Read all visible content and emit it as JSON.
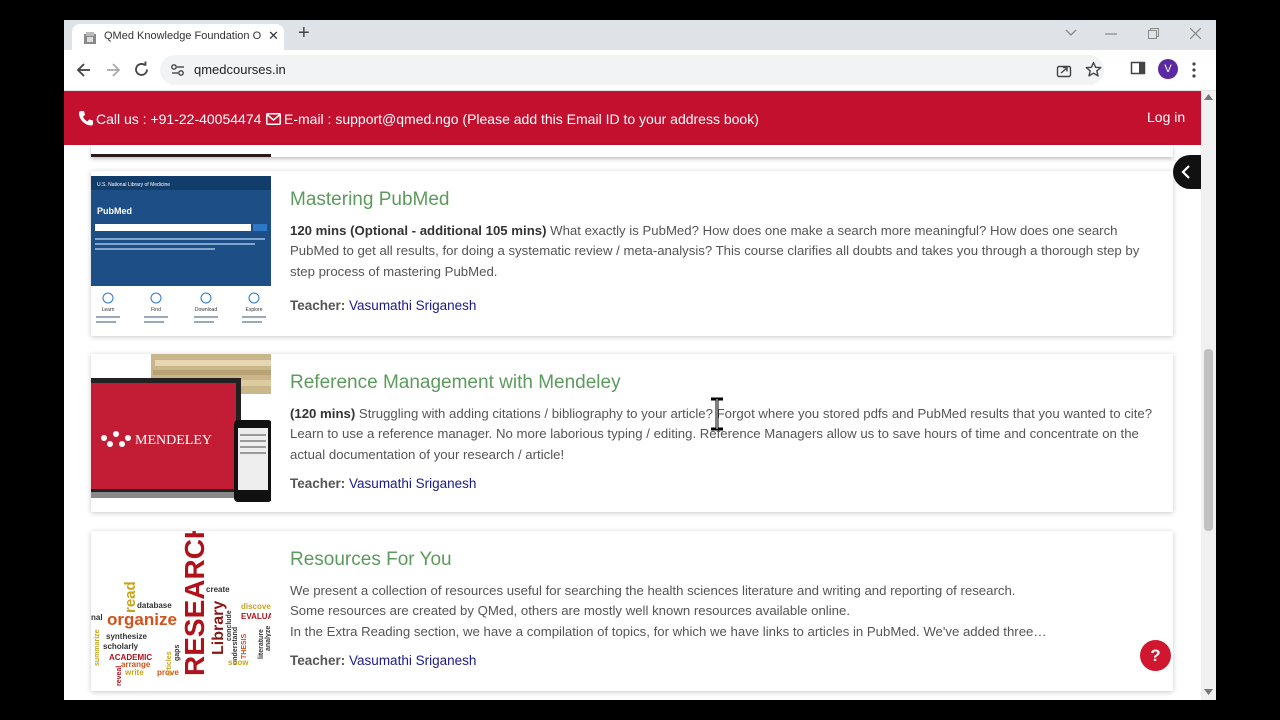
{
  "browser": {
    "tab_title": "QMed Knowledge Foundation O",
    "tab_close": "✕",
    "new_tab": "+",
    "url": "qmedcourses.in",
    "profile_initial": "V"
  },
  "site": {
    "phone_label": "Call us : +91-22-40054474",
    "email_label": "E-mail : support@qmed.ngo (Please add this Email ID to your address book)",
    "login": "Log in",
    "help": "?"
  },
  "courses": [
    {
      "title": "Mastering PubMed",
      "duration": "120 mins (Optional - additional 105 mins)",
      "description": " What exactly is PubMed? How does one make a search more meaningful? How does one search PubMed to get all results, for doing a systematic review / meta-analysis? This course clarifies all doubts and takes you through a thorough step by step process of mastering PubMed.",
      "teacher_label": "Teacher:",
      "teacher": "Vasumathi Sriganesh",
      "thumb": {
        "header": "U.S. National Library of Medicine",
        "logo": "PubMed",
        "features": [
          "Learn",
          "Find",
          "Download",
          "Explore"
        ]
      }
    },
    {
      "title": "Reference Management with Mendeley",
      "duration": "(120 mins)",
      "description": " Struggling with adding citations / bibliography to your article? Forgot where you stored pdfs and PubMed results that you wanted to cite? Learn to use a reference manager. No more laborious typing / editing. Reference Managers allow us to save hours of time and concentrate on the actual documentation of your research / article!",
      "teacher_label": "Teacher:",
      "teacher": "Vasumathi Sriganesh",
      "thumb": {
        "logo": "MENDELEY"
      }
    },
    {
      "title": "Resources For You",
      "description_lines": [
        "We present a collection of resources useful for searching the health sciences literature and writing and reporting of research.",
        "Some resources are created by QMed, others are mostly well known resources available online.",
        "In the Extra Reading section, we have a compilation of topics, for which we have links to articles in PubMed. We've added three…"
      ],
      "teacher_label": "Teacher:",
      "teacher": "Vasumathi Sriganesh",
      "thumb": {
        "words": [
          "RESEARCH",
          "organize",
          "read",
          "Library",
          "database",
          "synthesize",
          "scholarly",
          "ACADEMIC",
          "arrange",
          "write",
          "reveal",
          "summarize",
          "create",
          "discover",
          "EVALUATE",
          "THESIS",
          "understand",
          "literature",
          "analyze",
          "show",
          "prove",
          "gaps",
          "conclude",
          "articles",
          "nal"
        ]
      }
    }
  ],
  "colors": {
    "brand_red": "#c3102f",
    "title_green": "#5d9a5d",
    "teacher_link": "#1a1a8a"
  }
}
